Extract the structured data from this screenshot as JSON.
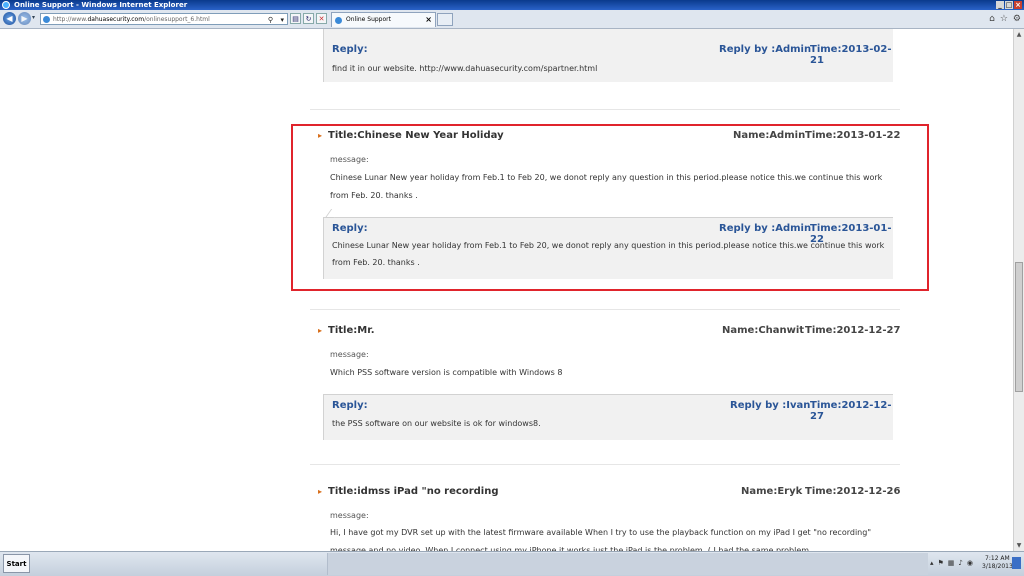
{
  "window": {
    "title": "Online Support - Windows Internet Explorer"
  },
  "browser": {
    "address_prefix": "http://www.",
    "address_domain": "dahuasecurity.com",
    "address_suffix": "/onlinesupport_6.html",
    "tab_label": "Online Support"
  },
  "posts": [
    {
      "reply_label": "Reply:",
      "reply_by": "Reply by :Admin",
      "reply_time": "Time:2013-02-21",
      "reply_text": "find it in our website. http://www.dahuasecurity.com/spartner.html"
    },
    {
      "title": "Title:Chinese New Year Holiday",
      "name": "Name:Admin",
      "time": "Time:2013-01-22",
      "message_label": "message:",
      "message": "Chinese Lunar New year holiday from Feb.1 to Feb 20, we donot reply any question in this period.please notice this.we continue this work from Feb. 20. thanks .",
      "reply_label": "Reply:",
      "reply_by": "Reply by :Admin",
      "reply_time": "Time:2013-01-22",
      "reply_text": "Chinese Lunar New year holiday from Feb.1 to Feb 20, we donot reply any question in this period.please notice this.we continue this work from Feb. 20. thanks ."
    },
    {
      "title": "Title:Mr.",
      "name": "Name:Chanwit",
      "time": "Time:2012-12-27",
      "message_label": "message:",
      "message": "Which PSS software version is compatible with Windows 8",
      "reply_label": "Reply:",
      "reply_by": "Reply by :Ivan",
      "reply_time": "Time:2012-12-27",
      "reply_text": "the PSS software on our website is ok for windows8."
    },
    {
      "title": "Title:idmss iPad \"no recording",
      "name": "Name:Eryk",
      "time": "Time:2012-12-26",
      "message_label": "message:",
      "message": "Hi, I have got my DVR set up with the latest firmware available When I try to use the playback function on my iPad I get \"no recording\" message and no video. When I connect using my iPhone it works just the iPad is the problem. ( I had the same problem"
    }
  ],
  "taskbar": {
    "start_label": "Start",
    "clock_time": "7:12 AM",
    "clock_date": "3/18/2013"
  },
  "colors": {
    "reply_blue": "#2a5597",
    "highlight_red": "#e0242c",
    "bullet_orange": "#d86e1a"
  }
}
